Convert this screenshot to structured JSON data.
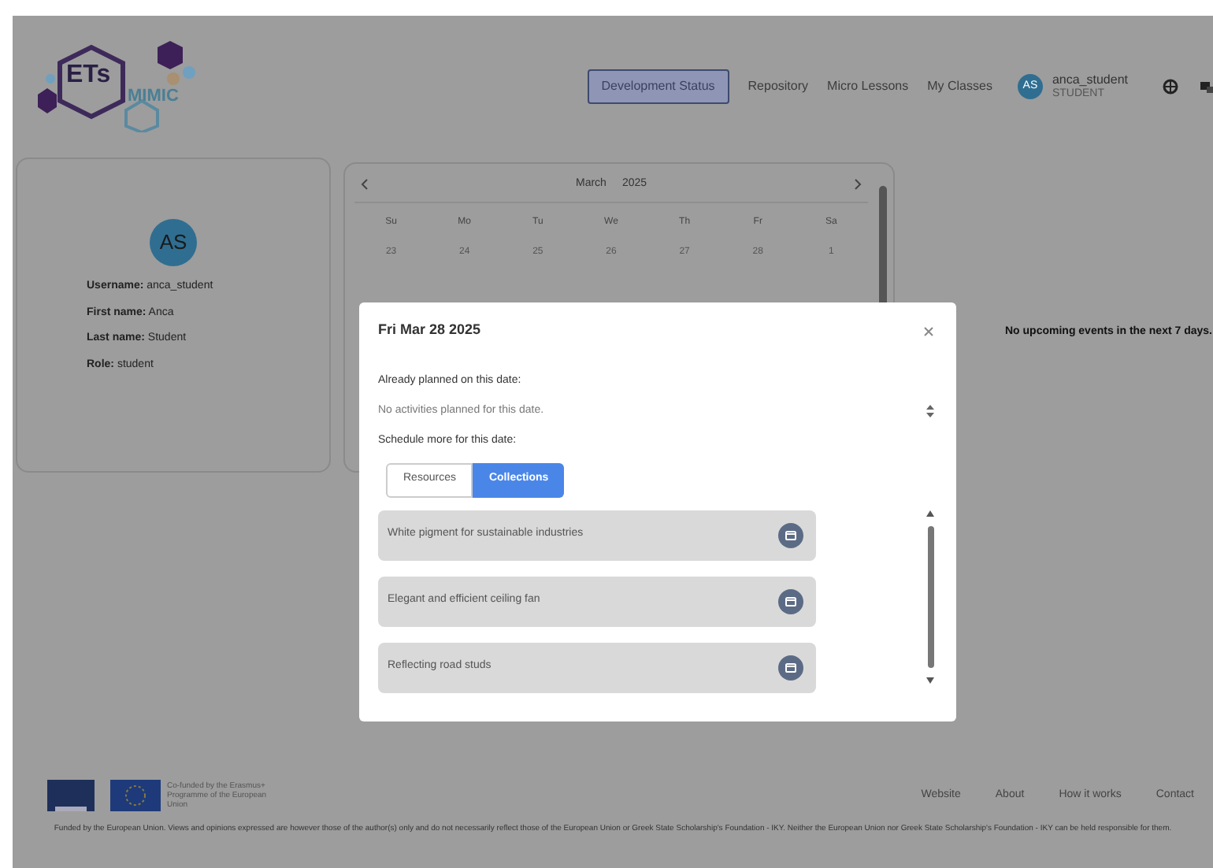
{
  "header": {
    "logo": {
      "text_main": "ETs",
      "text_sub": "MIMIC"
    },
    "nav": [
      {
        "label": "Development Status",
        "selected": true
      },
      {
        "label": "Repository",
        "selected": false
      },
      {
        "label": "Micro Lessons",
        "selected": false
      },
      {
        "label": "My Classes",
        "selected": false
      }
    ],
    "user": {
      "initials": "AS",
      "username": "anca_student",
      "role": "STUDENT"
    }
  },
  "profile": {
    "initials": "AS",
    "fields": [
      {
        "label": "Username:",
        "value": "anca_student"
      },
      {
        "label": "First name:",
        "value": "Anca"
      },
      {
        "label": "Last name:",
        "value": "Student"
      },
      {
        "label": "Role:",
        "value": "student"
      }
    ]
  },
  "calendar": {
    "month": "March",
    "year": "2025",
    "weekdays": [
      "Su",
      "Mo",
      "Tu",
      "We",
      "Th",
      "Fr",
      "Sa"
    ],
    "days": [
      "23",
      "24",
      "25",
      "26",
      "27",
      "28",
      "1"
    ]
  },
  "events": {
    "message": "No upcoming events in the next 7 days."
  },
  "dialog": {
    "title": "Fri Mar 28 2025",
    "planned_label": "Already planned on this date:",
    "planned_empty": "No activities planned for this date.",
    "schedule_label": "Schedule more for this date:",
    "tabs": [
      {
        "label": "Resources",
        "selected": false
      },
      {
        "label": "Collections",
        "selected": true
      }
    ],
    "items": [
      "White pigment for sustainable industries",
      "Elegant and efficient ceiling fan",
      "Reflecting road studs"
    ]
  },
  "footer": {
    "cofunded": "Co-funded by the Erasmus+ Programme of the European Union",
    "links": [
      "Website",
      "About",
      "How it works",
      "Contact"
    ],
    "disclaimer": "Funded by the European Union. Views and opinions expressed are however those of the author(s) only and do not necessarily reflect those of the European Union or Greek State Scholarship's Foundation - IKY. Neither the European Union nor Greek State Scholarship's Foundation - IKY can be held responsible for them."
  }
}
